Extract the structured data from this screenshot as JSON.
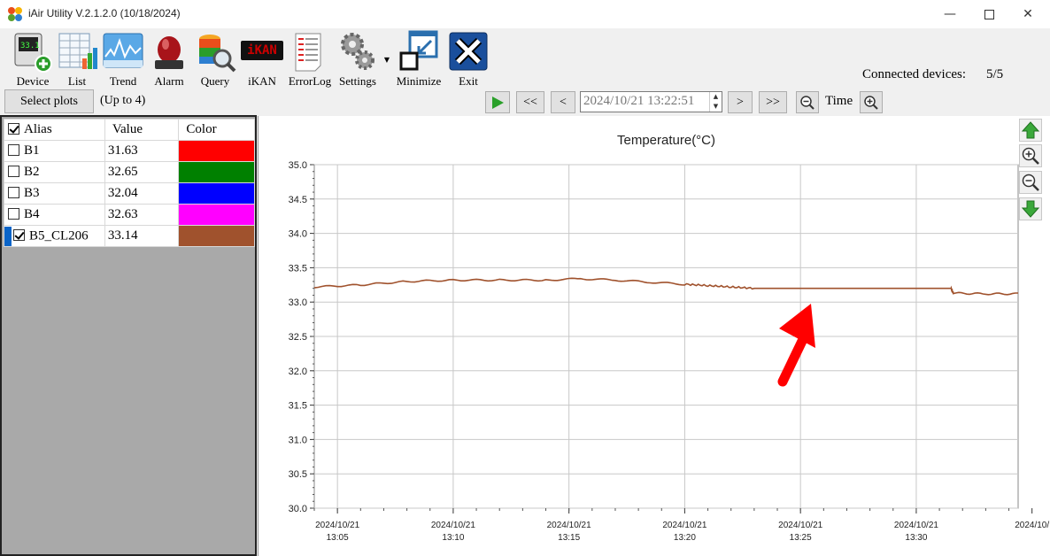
{
  "window": {
    "title": "iAir Utility V.2.1.2.0 (10/18/2024)"
  },
  "toolbar": {
    "items": [
      {
        "label": "Device",
        "icon": "device-icon"
      },
      {
        "label": "List",
        "icon": "list-icon"
      },
      {
        "label": "Trend",
        "icon": "trend-icon"
      },
      {
        "label": "Alarm",
        "icon": "alarm-icon"
      },
      {
        "label": "Query",
        "icon": "query-icon"
      },
      {
        "label": "iKAN",
        "icon": "ikan-icon"
      },
      {
        "label": "ErrorLog",
        "icon": "errorlog-icon"
      },
      {
        "label": "Settings",
        "icon": "settings-icon"
      },
      {
        "label": "Minimize",
        "icon": "minimize-icon"
      },
      {
        "label": "Exit",
        "icon": "exit-icon"
      }
    ],
    "ikan_logo": "iKAN",
    "connected_label": "Connected devices:",
    "connected_count": "5/5"
  },
  "controls": {
    "select_plots": "Select plots",
    "up_to": "(Up to 4)",
    "first": "<<",
    "prev": "<",
    "datetime": "2024/10/21 13:22:51",
    "next": ">",
    "last": ">>",
    "time_label": "Time"
  },
  "table": {
    "headers": [
      "Alias",
      "Value",
      "Color"
    ],
    "rows": [
      {
        "alias": "B1",
        "value": "31.63",
        "color": "#ff0000",
        "checked": false
      },
      {
        "alias": "B2",
        "value": "32.65",
        "color": "#008000",
        "checked": false
      },
      {
        "alias": "B3",
        "value": "32.04",
        "color": "#0000ff",
        "checked": false
      },
      {
        "alias": "B4",
        "value": "32.63",
        "color": "#ff00ff",
        "checked": false
      },
      {
        "alias": "B5_CL206",
        "value": "33.14",
        "color": "#a0522d",
        "checked": true
      }
    ]
  },
  "chart_data": {
    "type": "line",
    "title": "Temperature(°C)",
    "ylim": [
      30.0,
      35.0
    ],
    "y_ticks": [
      "30.0",
      "30.5",
      "31.0",
      "31.5",
      "32.0",
      "32.5",
      "33.0",
      "33.5",
      "34.0",
      "34.5",
      "35.0"
    ],
    "x_ticks": [
      {
        "date": "2024/10/21",
        "time": "13:05",
        "minute": 5
      },
      {
        "date": "2024/10/21",
        "time": "13:10",
        "minute": 10
      },
      {
        "date": "2024/10/21",
        "time": "13:15",
        "minute": 15
      },
      {
        "date": "2024/10/21",
        "time": "13:20",
        "minute": 20
      },
      {
        "date": "2024/10/21",
        "time": "13:25",
        "minute": 25
      },
      {
        "date": "2024/10/21",
        "time": "13:30",
        "minute": 30
      },
      {
        "date": "2024/10/",
        "time": "",
        "minute": 35
      }
    ],
    "xlim_minutes": [
      4.0,
      34.4
    ],
    "grid": true,
    "series": [
      {
        "color": "#a0522d",
        "x": [
          4.0,
          6.0,
          8.0,
          10.0,
          12.0,
          14.0,
          15.5,
          17.0,
          18.5,
          20.0,
          21.0,
          22.0,
          23.0,
          25.0,
          27.0,
          29.0,
          30.0,
          31.5,
          31.6,
          33.0,
          34.4
        ],
        "y": [
          33.22,
          33.25,
          33.3,
          33.32,
          33.32,
          33.32,
          33.34,
          33.32,
          33.29,
          33.26,
          33.24,
          33.22,
          33.2,
          33.2,
          33.2,
          33.2,
          33.2,
          33.2,
          33.13,
          33.12,
          33.12
        ]
      }
    ]
  },
  "annotation": {
    "arrow_color": "#ff0000"
  }
}
